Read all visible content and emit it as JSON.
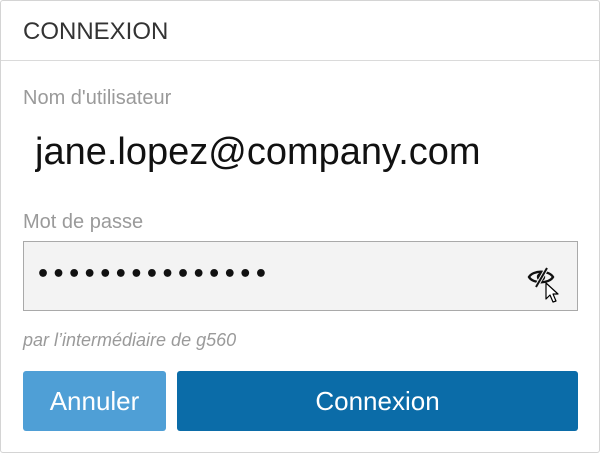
{
  "dialog": {
    "title": "CONNEXION"
  },
  "username": {
    "label": "Nom d'utilisateur",
    "value": "jane.lopez@company.com"
  },
  "password": {
    "label": "Mot de passe",
    "masked_value": "•••••••••••••••",
    "toggle_icon": "eye-slash-icon"
  },
  "via_text": "par l’intermédiaire de g560",
  "buttons": {
    "cancel_label": "Annuler",
    "login_label": "Connexion"
  },
  "colors": {
    "primary": "#0b6ca8",
    "secondary": "#4f9fd6",
    "muted_text": "#9a9a9a"
  }
}
